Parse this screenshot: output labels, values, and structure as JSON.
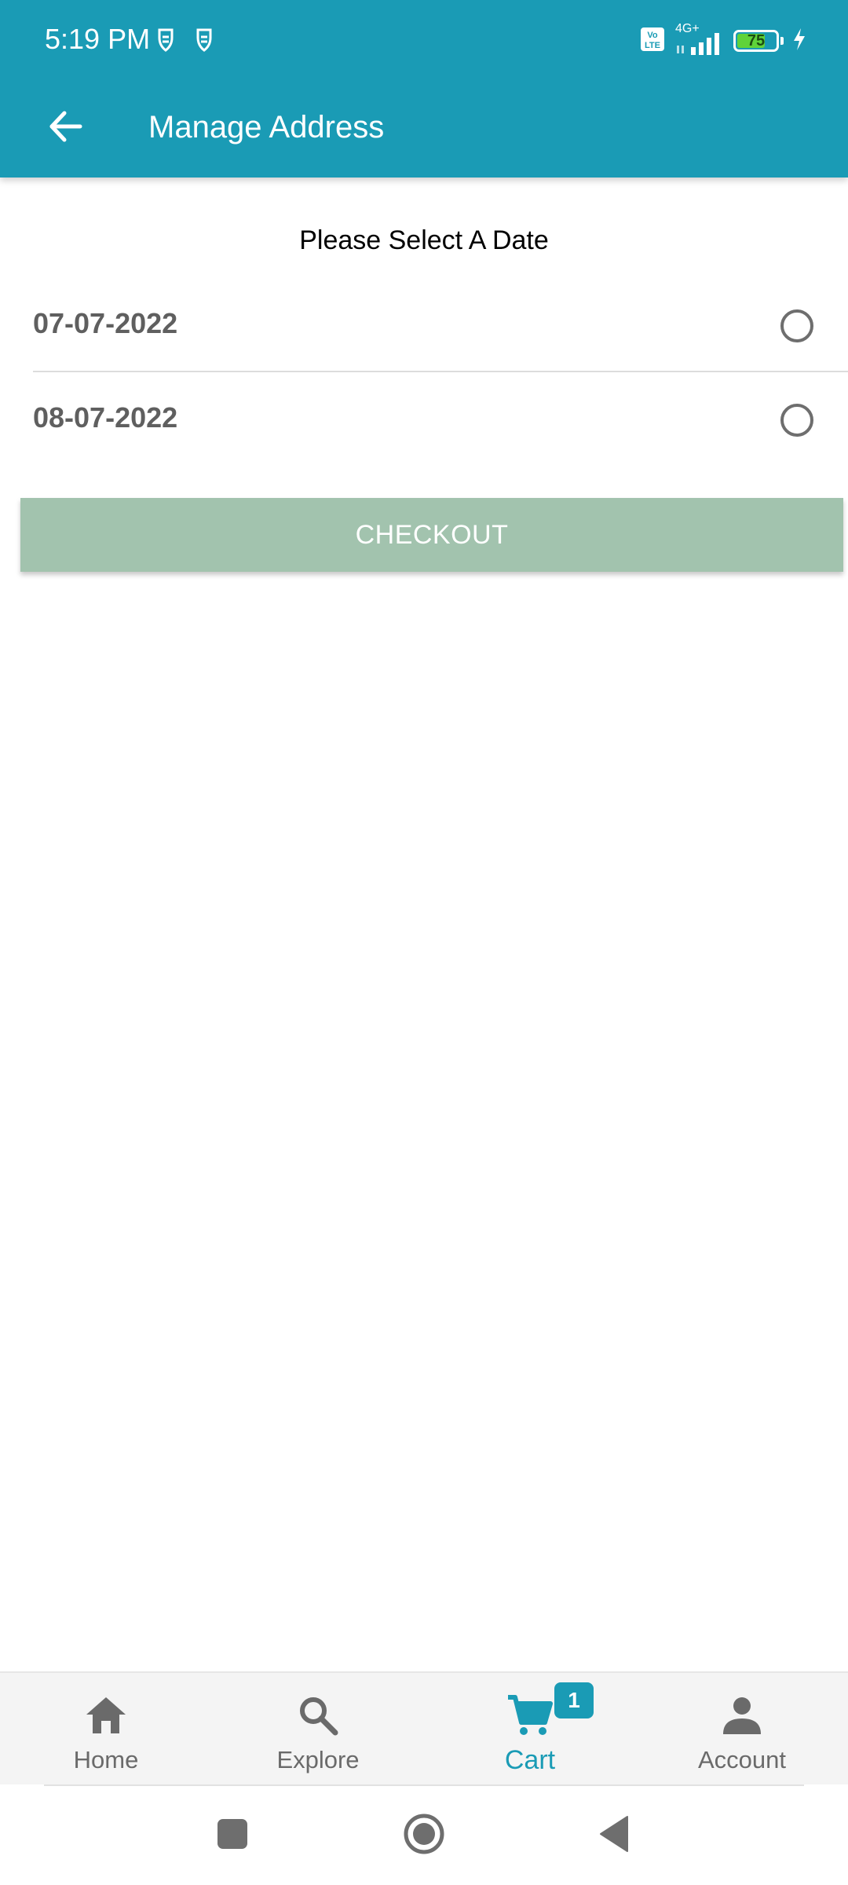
{
  "status_bar": {
    "time": "5:19 PM",
    "network": "4G+",
    "volte": "Vo LTE",
    "battery_level": "75",
    "battery_fraction": 0.75,
    "icons": [
      "notification-icon",
      "notification-icon",
      "volte-icon",
      "signal-icon",
      "battery-icon",
      "charging-icon"
    ]
  },
  "toolbar": {
    "title": "Manage Address",
    "back_icon": "arrow-left-icon"
  },
  "date_picker": {
    "heading": "Please Select A Date",
    "options": [
      {
        "label": "07-07-2022",
        "selected": false
      },
      {
        "label": "08-07-2022",
        "selected": false
      }
    ]
  },
  "checkout": {
    "label": "CHECKOUT"
  },
  "bottom_nav": {
    "items": [
      {
        "label": "Home",
        "icon": "home-icon",
        "active": false
      },
      {
        "label": "Explore",
        "icon": "search-icon",
        "active": false
      },
      {
        "label": "Cart",
        "icon": "cart-icon",
        "active": true,
        "badge": "1"
      },
      {
        "label": "Account",
        "icon": "person-icon",
        "active": false
      }
    ]
  },
  "colors": {
    "primary": "#1a9bb5",
    "checkout_button": "#a2c3ae",
    "inactive_nav": "#6a6a6a",
    "battery": "#5fd33a"
  },
  "system_nav": {
    "icons": [
      "recents-square-icon",
      "home-circle-icon",
      "back-triangle-icon"
    ]
  }
}
